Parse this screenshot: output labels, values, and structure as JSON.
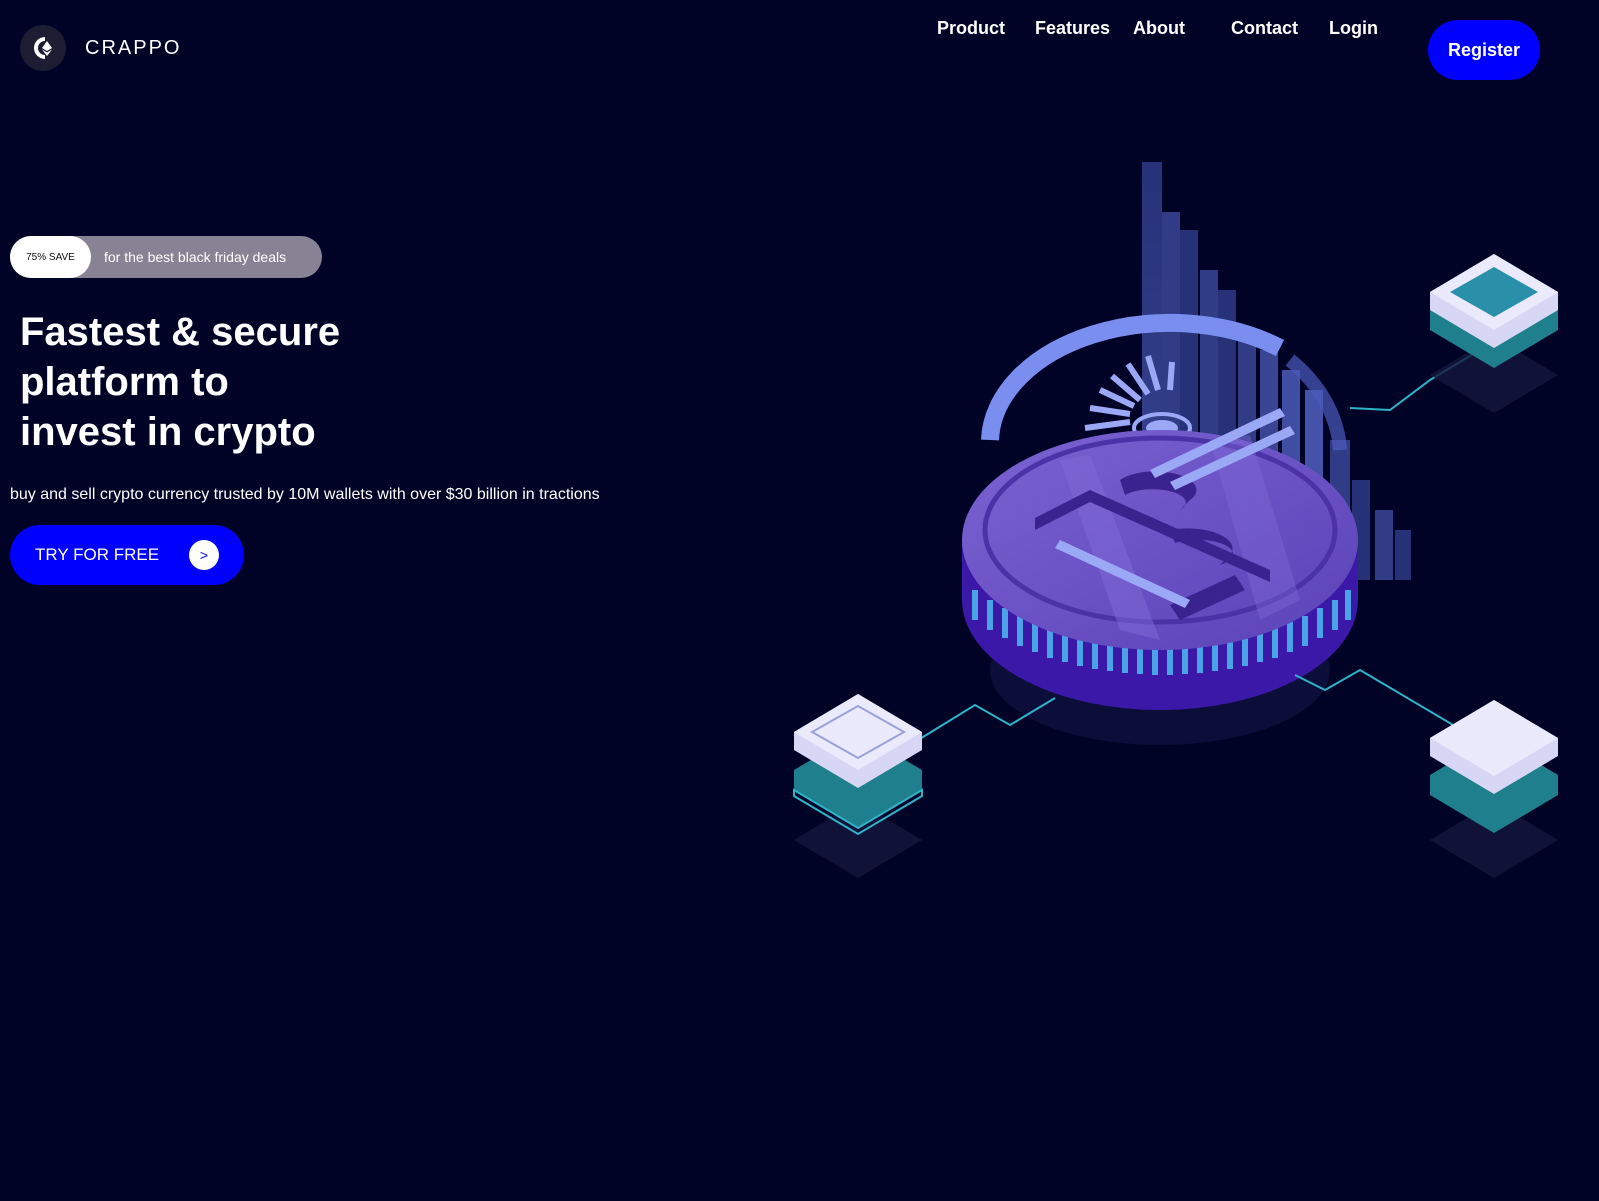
{
  "header": {
    "brand": "CRAPPO",
    "nav": [
      "Product",
      "Features",
      "About",
      "Contact",
      "Login"
    ],
    "register_label": "Register"
  },
  "promo": {
    "badge": "75% SAVE",
    "text": "for the best black friday deals"
  },
  "hero": {
    "title_lines": [
      "Fastest & secure",
      "platform to",
      "invest in crypto"
    ],
    "subtitle": "buy and sell crypto currency trusted by 10M wallets with over $30 billion in tractions",
    "cta_label": "TRY FOR FREE",
    "cta_arrow": ">"
  },
  "colors": {
    "background": "#010326",
    "accent": "#0000ff",
    "promo_pill": "#878395",
    "coin": "#6a4fc0"
  },
  "icons": [
    "crappo-logo-icon",
    "arrow-right-icon",
    "bitcoin-coin-illustration"
  ]
}
